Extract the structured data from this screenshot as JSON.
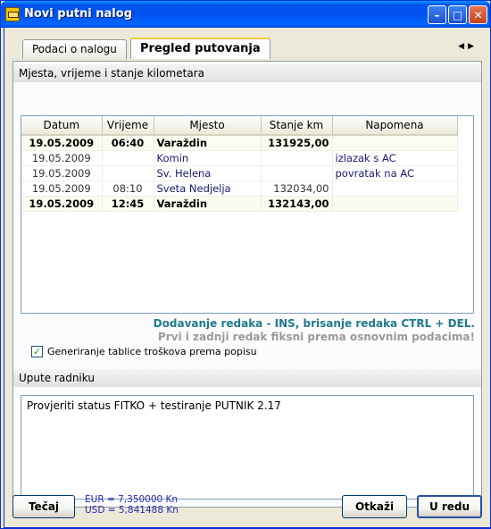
{
  "window": {
    "title": "Novi putni nalog"
  },
  "tabs": [
    {
      "label": "Podaci o nalogu",
      "active": false
    },
    {
      "label": "Pregled putovanja",
      "active": true
    }
  ],
  "section_km": {
    "title": "Mjesta, vrijeme i stanje kilometara"
  },
  "grid": {
    "columns": [
      "Datum",
      "Vrijeme",
      "Mjesto",
      "Stanje km",
      "Napomena"
    ],
    "rows": [
      {
        "datum": "19.05.2009",
        "vrijeme": "06:40",
        "mjesto": "Varaždin",
        "stanje_km": "131925,00",
        "napomena": "",
        "bold": true
      },
      {
        "datum": "19.05.2009",
        "vrijeme": "",
        "mjesto": "Komin",
        "stanje_km": "",
        "napomena": "izlazak s AC",
        "bold": false
      },
      {
        "datum": "19.05.2009",
        "vrijeme": "",
        "mjesto": "Sv. Helena",
        "stanje_km": "",
        "napomena": "povratak na AC",
        "bold": false
      },
      {
        "datum": "19.05.2009",
        "vrijeme": "08:10",
        "mjesto": "Sveta Nedjelja",
        "stanje_km": "132034,00",
        "napomena": "",
        "bold": false
      },
      {
        "datum": "19.05.2009",
        "vrijeme": "12:45",
        "mjesto": "Varaždin",
        "stanje_km": "132143,00",
        "napomena": "",
        "bold": true
      }
    ]
  },
  "hints": {
    "line1": "Dodavanje redaka - INS, brisanje redaka CTRL + DEL.",
    "line2": "Prvi i zadnji redak fiksni prema osnovnim podacima!"
  },
  "checkbox": {
    "label": "Generiranje tablice troškova prema popisu",
    "checked": true
  },
  "section_notes": {
    "title": "Upute radniku"
  },
  "notes": {
    "value": "Provjeriti status FITKO + testiranje PUTNIK 2.17"
  },
  "footer": {
    "rate_button": "Tečaj",
    "eur_rate": "EUR = 7,350000 Kn",
    "usd_rate": "USD = 5,841488 Kn",
    "cancel_button": "Otkaži",
    "ok_button": "U redu"
  },
  "colors": {
    "titlebar": "#0053ee",
    "hint_teal": "#217b8c",
    "hint_gray": "#9a9a9a",
    "rates_blue": "#2a2ab4"
  }
}
